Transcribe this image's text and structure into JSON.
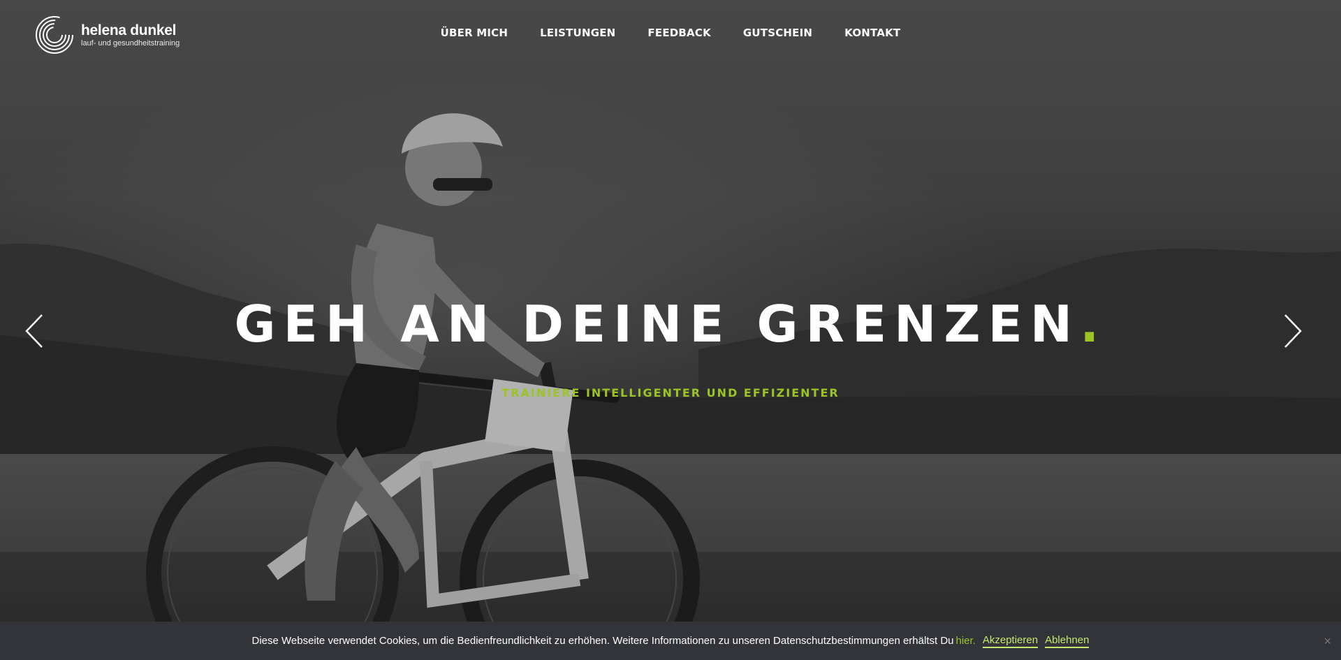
{
  "header": {
    "logo": {
      "name": "helena dunkel",
      "tagline": "lauf- und gesundheitstraining"
    },
    "nav": [
      {
        "label": "ÜBER MICH"
      },
      {
        "label": "LEISTUNGEN"
      },
      {
        "label": "FEEDBACK"
      },
      {
        "label": "GUTSCHEIN"
      },
      {
        "label": "KONTAKT"
      }
    ]
  },
  "hero": {
    "headline": "GEH AN DEINE GRENZEN",
    "headline_dot": ".",
    "subline": "TRAINIERE INTELLIGENTER UND EFFIZIENTER",
    "prev_icon": "chevron-left-icon",
    "next_icon": "chevron-right-icon"
  },
  "cookie": {
    "text": "Diese Webseite verwendet Cookies, um die Bedienfreundlichkeit zu erhöhen. Weitere Informationen zu unseren Datenschutzbestimmungen erhältst Du",
    "link": "hier.",
    "accept": "Akzeptieren",
    "decline": "Ablehnen",
    "close": "×"
  },
  "colors": {
    "accent": "#9bc424",
    "cookie_bg": "#32343a",
    "cookie_button": "#c7e86c"
  }
}
